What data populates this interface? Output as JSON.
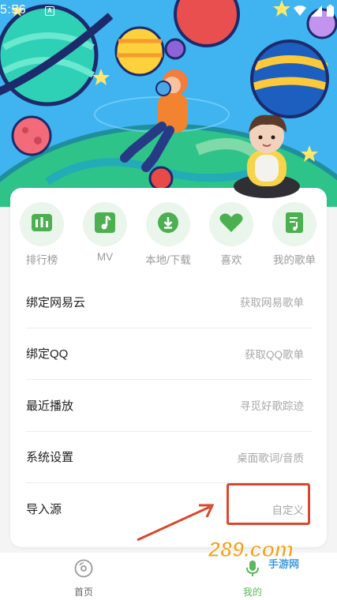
{
  "status_bar": {
    "time": "5:56",
    "badge": "A"
  },
  "quick_actions": [
    {
      "label": "排行榜",
      "icon": "chart-bars-icon"
    },
    {
      "label": "MV",
      "icon": "music-note-icon"
    },
    {
      "label": "本地/下载",
      "icon": "download-icon"
    },
    {
      "label": "喜欢",
      "icon": "heart-icon"
    },
    {
      "label": "我的歌单",
      "icon": "playlist-icon"
    }
  ],
  "menu": [
    {
      "title": "绑定网易云",
      "subtitle": "获取网易歌单"
    },
    {
      "title": "绑定QQ",
      "subtitle": "获取QQ歌单"
    },
    {
      "title": "最近播放",
      "subtitle": "寻觅好歌踪迹"
    },
    {
      "title": "系统设置",
      "subtitle": "桌面歌词/音质"
    },
    {
      "title": "导入源",
      "subtitle": "自定义"
    }
  ],
  "bottom_nav": [
    {
      "label": "首页",
      "icon": "disc-icon",
      "active": false
    },
    {
      "label": "我的",
      "icon": "mic-icon",
      "active": true
    }
  ],
  "watermark": {
    "text": "289.com",
    "subtext": "手游网"
  },
  "colors": {
    "accent": "#4caf50",
    "icon_bg": "#eaf5ec",
    "highlight": "#d9482e",
    "active_nav": "#5cb85c"
  }
}
